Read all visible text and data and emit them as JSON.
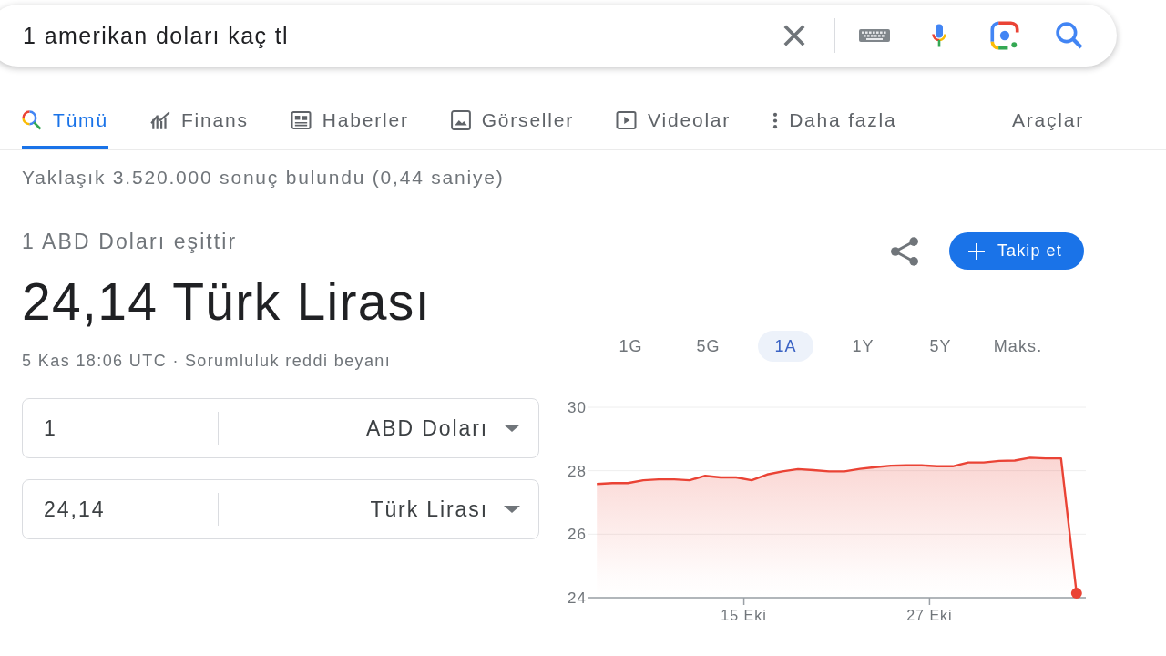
{
  "search": {
    "value": "1 amerikan doları kaç tl"
  },
  "tabs": [
    {
      "kind": "all",
      "label": "Tümü",
      "selected": true
    },
    {
      "kind": "finance",
      "label": "Finans",
      "selected": false
    },
    {
      "kind": "news",
      "label": "Haberler",
      "selected": false
    },
    {
      "kind": "images",
      "label": "Görseller",
      "selected": false
    },
    {
      "kind": "videos",
      "label": "Videolar",
      "selected": false
    },
    {
      "kind": "more",
      "label": "Daha fazla",
      "selected": false
    }
  ],
  "tools": "Araçlar",
  "result_stats": "Yaklaşık 3.520.000 sonuç bulundu (0,44 saniye)",
  "conversion": {
    "caption": "1 ABD Doları eşittir",
    "result": "24,14 Türk Lirası",
    "timestamp": "5 Kas 18:06 UTC ·",
    "disclaimer": "Sorumluluk reddi beyanı"
  },
  "converter": [
    {
      "amount": "1",
      "currency": "ABD Doları"
    },
    {
      "amount": "24,14",
      "currency": "Türk Lirası"
    }
  ],
  "follow_button": "Takip et",
  "ranges": [
    {
      "label": "1G",
      "selected": false
    },
    {
      "label": "5G",
      "selected": false
    },
    {
      "label": "1A",
      "selected": true
    },
    {
      "label": "1Y",
      "selected": false
    },
    {
      "label": "5Y",
      "selected": false
    },
    {
      "label": "Maks.",
      "selected": false
    }
  ],
  "chart_data": {
    "type": "area",
    "x": [
      5.5,
      6.5,
      7.5,
      8.5,
      9.5,
      10.5,
      11.5,
      12.5,
      13.5,
      14.5,
      15.5,
      16.5,
      17.5,
      18.5,
      19.5,
      20.5,
      21.5,
      22.5,
      23.5,
      24.5,
      25.5,
      26.5,
      27.5,
      28.5,
      29.5,
      30.5,
      31.5,
      32.5,
      33.5,
      34.5,
      35.5,
      36.5
    ],
    "series": [
      {
        "color": "#ea4335",
        "values": [
          27.58,
          27.61,
          27.61,
          27.7,
          27.73,
          27.73,
          27.7,
          27.84,
          27.79,
          27.79,
          27.7,
          27.88,
          27.98,
          28.05,
          28.02,
          27.98,
          27.98,
          28.06,
          28.11,
          28.16,
          28.17,
          28.17,
          28.14,
          28.14,
          28.26,
          28.26,
          28.31,
          28.32,
          28.41,
          28.39,
          28.39,
          24.14
        ]
      }
    ],
    "xlim": [
      4.9,
      37.1
    ],
    "ylim": [
      24,
      30
    ],
    "xticks": [
      {
        "value": 15,
        "label": "15 Eki"
      },
      {
        "value": 27,
        "label": "27 Eki"
      }
    ],
    "yticks": [
      24,
      26,
      28,
      30
    ]
  }
}
